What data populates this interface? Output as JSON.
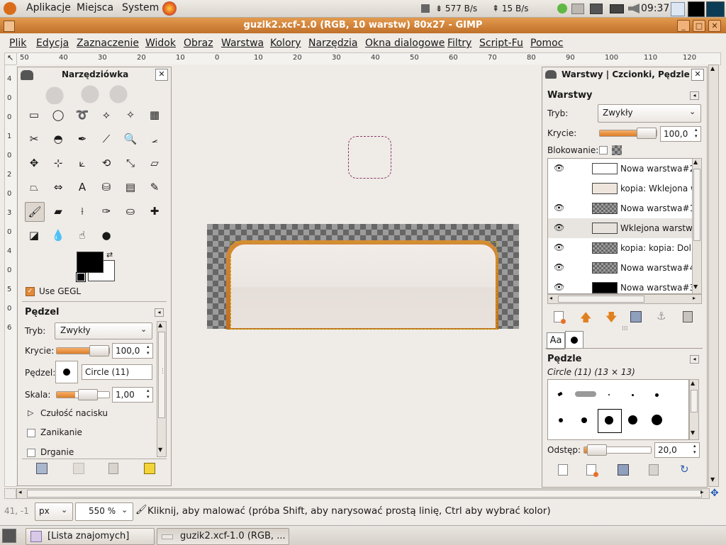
{
  "top_panel": {
    "menus": [
      "Aplikacje",
      "Miejsca",
      "System"
    ],
    "download_speed": "577 B/s",
    "upload_speed": "15 B/s",
    "clock": "09:37"
  },
  "window": {
    "title": "guzik2.xcf-1.0 (RGB, 10 warstw) 80x27 - GIMP",
    "menu": [
      "Plik",
      "Edycja",
      "Zaznaczenie",
      "Widok",
      "Obraz",
      "Warstwa",
      "Kolory",
      "Narzędzia",
      "Okna dialogowe",
      "Filtry",
      "Script-Fu",
      "Pomoc"
    ]
  },
  "rulers": {
    "top": [
      "50",
      "40",
      "30",
      "20",
      "10",
      "0",
      "10",
      "20",
      "30",
      "40",
      "50",
      "60",
      "70",
      "80",
      "90",
      "100",
      "110",
      "120"
    ],
    "left": [
      "4",
      "0",
      "0",
      "1",
      "0",
      "2",
      "0",
      "3",
      "0",
      "4",
      "0",
      "5",
      "0",
      "6"
    ]
  },
  "toolbox": {
    "title": "Narzędziówka",
    "use_gegl": "Use GEGL",
    "options_title": "Pędzel",
    "mode_label": "Tryb:",
    "mode_value": "Zwykły",
    "opacity_label": "Krycie:",
    "opacity_value": "100,0",
    "brush_label": "Pędzel:",
    "brush_value": "Circle (11)",
    "scale_label": "Skala:",
    "scale_value": "1,00",
    "pressure_label": "Czułość nacisku",
    "fade_label": "Zanikanie",
    "jitter_label": "Drganie"
  },
  "layers_dock": {
    "tab_title": "Warstwy | Czcionki, Pędzle",
    "section_title": "Warstwy",
    "mode_label": "Tryb:",
    "mode_value": "Zwykły",
    "opacity_label": "Krycie:",
    "opacity_value": "100,0",
    "lock_label": "Blokowanie:",
    "layers": [
      {
        "name": "Nowa warstwa#2",
        "visible": true
      },
      {
        "name": "kopia: Wklejona w",
        "visible": false
      },
      {
        "name": "Nowa warstwa#1",
        "visible": true
      },
      {
        "name": "Wklejona warstwa",
        "visible": true
      },
      {
        "name": "kopia: kopia: Doln",
        "visible": true
      },
      {
        "name": "Nowa warstwa#4",
        "visible": true
      },
      {
        "name": "Nowa warstwa#3",
        "visible": true
      }
    ],
    "text_tab": "Aa",
    "brushes_title": "Pędzle",
    "brush_name": "Circle (11) (13 × 13)",
    "spacing_label": "Odstęp:",
    "spacing_value": "20,0"
  },
  "status": {
    "coords": "41, -1",
    "unit": "px",
    "zoom": "550 %",
    "message": "Kliknij, aby malować (próba Shift, aby narysować prostą linię, Ctrl aby wybrać kolor)"
  },
  "taskbar": {
    "items": [
      "[Lista znajomych]",
      "guzik2.xcf-1.0 (RGB, ..."
    ]
  },
  "colors": {
    "accent": "#dd7d28",
    "titlebar": "#d07f36",
    "foreground": "#000000",
    "background": "#ffffff"
  }
}
